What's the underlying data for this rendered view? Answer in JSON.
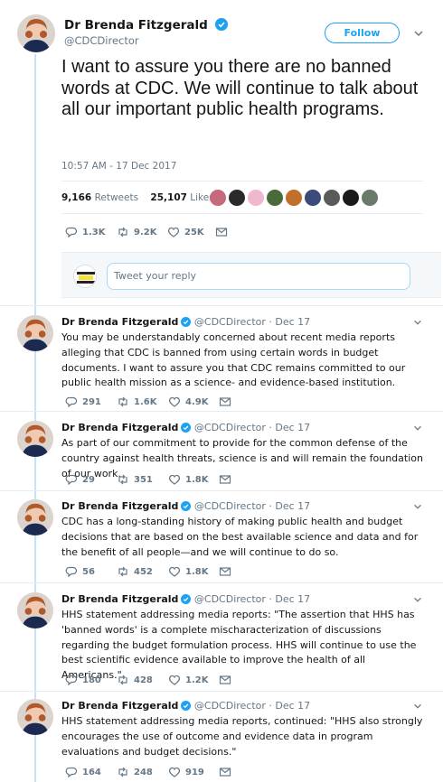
{
  "main_tweet": {
    "author_name": "Dr Brenda Fitzgerald",
    "handle": "@CDCDirector",
    "follow_label": "Follow",
    "text": "I want to assure you there are no banned words at CDC. We will continue to talk about all our important public health programs.",
    "timestamp": "10:57 AM - 17 Dec 2017",
    "retweets_count": "9,166",
    "retweets_label": "Retweets",
    "likes_count": "25,107",
    "likes_label": "Likes",
    "reply_count": "1.3K",
    "retweet_count": "9.2K",
    "like_count": "25K"
  },
  "reply_box": {
    "placeholder": "Tweet your reply"
  },
  "thread": [
    {
      "author_name": "Dr Brenda Fitzgerald",
      "meta": "@CDCDirector · Dec 17",
      "text": "You may be understandably concerned about recent media reports alleging that CDC is banned from using certain words in budget documents. I want to assure you that CDC remains committed to our public health mission as a science- and evidence-based institution.",
      "replies": "291",
      "retweets": "1.6K",
      "likes": "4.9K"
    },
    {
      "author_name": "Dr Brenda Fitzgerald",
      "meta": "@CDCDirector · Dec 17",
      "text": "As part of our commitment to provide for the common defense of the country against health threats, science is and will remain the foundation of our work.",
      "replies": "29",
      "retweets": "351",
      "likes": "1.8K"
    },
    {
      "author_name": "Dr Brenda Fitzgerald",
      "meta": "@CDCDirector · Dec 17",
      "text": "CDC has a long-standing history of making public health and budget decisions that are based on the best available science and data and for the benefit of all people—and we will continue to do so.",
      "replies": "56",
      "retweets": "452",
      "likes": "1.8K"
    },
    {
      "author_name": "Dr Brenda Fitzgerald",
      "meta": "@CDCDirector · Dec 17",
      "text": "HHS statement addressing media reports: \"The assertion that HHS has 'banned words' is a complete mischaracterization of discussions regarding the budget formulation process. HHS will continue to use the best scientific evidence available to improve the health of all Americans.\"",
      "replies": "180",
      "retweets": "428",
      "likes": "1.2K"
    },
    {
      "author_name": "Dr Brenda Fitzgerald",
      "meta": "@CDCDirector · Dec 17",
      "text": "HHS statement addressing media reports, continued: \"HHS also strongly encourages the use of outcome and evidence data in program evaluations and budget decisions.\"",
      "replies": "164",
      "retweets": "248",
      "likes": "919"
    }
  ],
  "colors": {
    "accent": "#1da1f2",
    "muted": "#657786",
    "thread_line": "#c4e3f9"
  },
  "icons": [
    "verified-badge-icon",
    "chevron-down-icon",
    "reply-icon",
    "retweet-icon",
    "heart-icon",
    "envelope-icon"
  ]
}
